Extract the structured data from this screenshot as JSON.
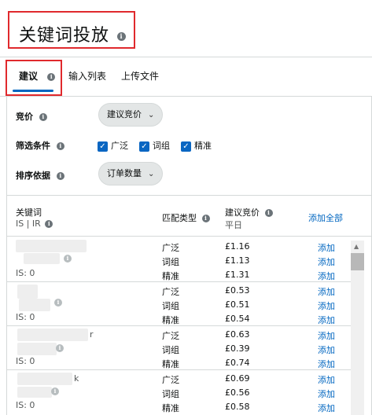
{
  "header": {
    "title": "关键词投放"
  },
  "tabs": [
    {
      "label": "建议",
      "active": true
    },
    {
      "label": "输入列表"
    },
    {
      "label": "上传文件"
    }
  ],
  "filters": {
    "bid_label": "竞价",
    "bid_value": "建议竞价",
    "filter_label": "筛选条件",
    "options": [
      {
        "label": "广泛",
        "checked": true
      },
      {
        "label": "词组",
        "checked": true
      },
      {
        "label": "精准",
        "checked": true
      }
    ],
    "sort_label": "排序依据",
    "sort_value": "订单数量"
  },
  "table": {
    "col_keyword": "关键词",
    "col_keyword_sub": "IS | IR",
    "col_match": "匹配类型",
    "col_bid": "建议竞价",
    "col_bid_sub": "平日",
    "add_all": "添加全部",
    "add_label": "添加",
    "groups": [
      {
        "kw_suffix": "",
        "is_text": "IS: 0",
        "rows": [
          {
            "match": "广泛",
            "bid": "£1.16"
          },
          {
            "match": "词组",
            "bid": "£1.13"
          },
          {
            "match": "精准",
            "bid": "£1.31"
          }
        ]
      },
      {
        "kw_suffix": "",
        "is_text": "IS: 0",
        "rows": [
          {
            "match": "广泛",
            "bid": "£0.53"
          },
          {
            "match": "词组",
            "bid": "£0.51"
          },
          {
            "match": "精准",
            "bid": "£0.54"
          }
        ]
      },
      {
        "kw_suffix": "r",
        "is_text": "IS: 0",
        "rows": [
          {
            "match": "广泛",
            "bid": "£0.63"
          },
          {
            "match": "词组",
            "bid": "£0.39"
          },
          {
            "match": "精准",
            "bid": "£0.74"
          }
        ]
      },
      {
        "kw_suffix": "k",
        "is_text": "IS: 0",
        "rows": [
          {
            "match": "广泛",
            "bid": "£0.69"
          },
          {
            "match": "词组",
            "bid": "£0.56"
          },
          {
            "match": "精准",
            "bid": "£0.58"
          }
        ]
      }
    ]
  }
}
